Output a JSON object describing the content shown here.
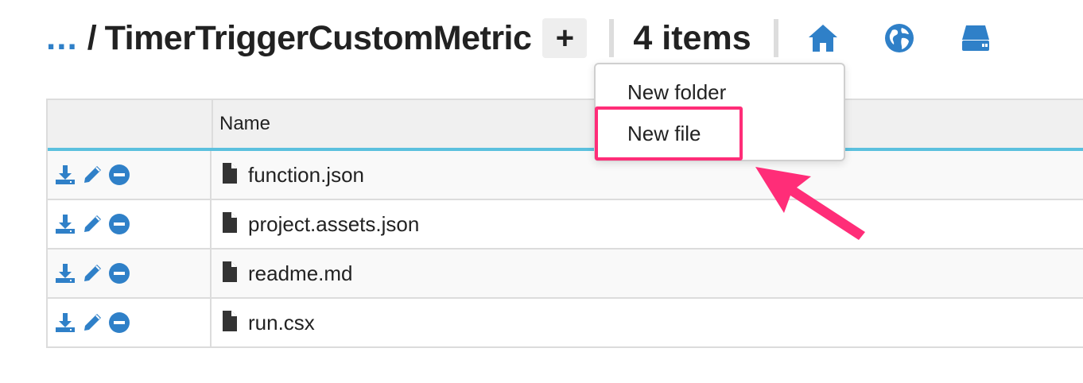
{
  "header": {
    "breadcrumb_ellipsis": "...",
    "breadcrumb_separator": "/",
    "current_folder": "TimerTriggerCustomMetric",
    "add_button_label": "+",
    "items_count": "4 items",
    "icons": [
      "home-icon",
      "globe-icon",
      "drive-icon"
    ]
  },
  "dropdown": {
    "items": [
      {
        "label": "New folder"
      },
      {
        "label": "New file"
      }
    ],
    "highlighted": "New file"
  },
  "table": {
    "columns": [
      "",
      "Name"
    ],
    "rows": [
      {
        "name": "function.json"
      },
      {
        "name": "project.assets.json"
      },
      {
        "name": "readme.md"
      },
      {
        "name": "run.csx"
      }
    ],
    "row_actions": [
      "download-icon",
      "edit-icon",
      "delete-icon"
    ]
  },
  "colors": {
    "accent_blue": "#2f80c8",
    "header_underline": "#5bc0de",
    "highlight_pink": "#ff2d78"
  }
}
